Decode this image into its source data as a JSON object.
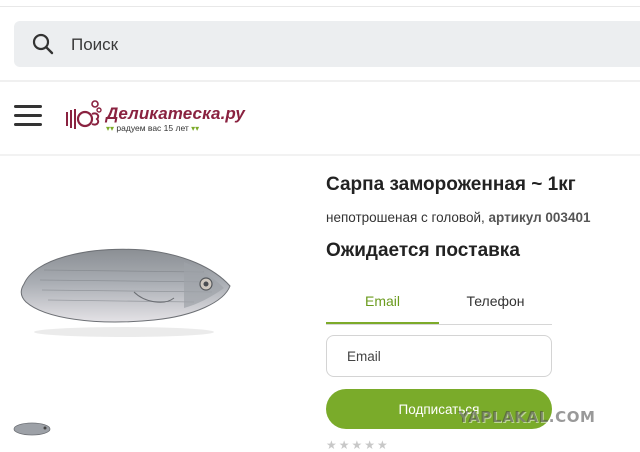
{
  "search": {
    "placeholder": "Поиск",
    "icon": "search-icon"
  },
  "header": {
    "menu_icon": "hamburger-menu-icon",
    "logo": {
      "name": "Деликатеска.ру",
      "tagline": "радуем вас 15 лет"
    }
  },
  "product": {
    "title": "Сарпа замороженная ~ 1кг",
    "description": "непотрошеная с головой,",
    "article": "артикул 003401",
    "availability": "Ожидается поставка"
  },
  "subscribe_form": {
    "tabs": [
      {
        "label": "Email",
        "active": true
      },
      {
        "label": "Телефон",
        "active": false
      }
    ],
    "email_placeholder": "Email",
    "button_label": "Подписаться"
  },
  "rating": {
    "stars": "★★★★★"
  },
  "watermark": "YAPLAKAL.COM",
  "colors": {
    "accent_green": "#7aab2a",
    "brand": "#8a2240",
    "search_bg": "#eceef0"
  }
}
